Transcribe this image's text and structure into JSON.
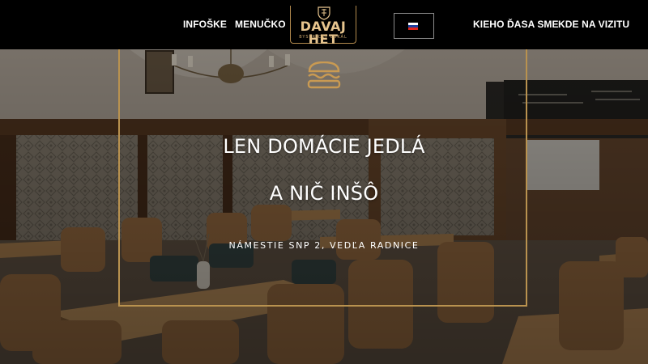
{
  "nav": {
    "infoske": "INFOŠKE",
    "menucko": "MENUČKO",
    "kieho": "KIEHO ĎASA SME",
    "kde": "KDE NA VIZITU"
  },
  "logo": {
    "name": "DAVAJ HET",
    "subtitle": "BYSTRICKÝ LOKÁL",
    "emblem_icon": "coat-of-arms-icon"
  },
  "language": {
    "selected": "sk",
    "flag_icon": "slovak-flag-icon"
  },
  "hero": {
    "icon": "burger-icon",
    "headline_1": "LEN DOMÁCIE JEDLÁ",
    "headline_2": "A NIČ INŠÔ",
    "address": "NÁMESTIE SNP 2, VEDĽA RADNICE"
  },
  "colors": {
    "header_bg": "#000000",
    "accent_gold": "#b9924f",
    "text": "#ffffff"
  }
}
